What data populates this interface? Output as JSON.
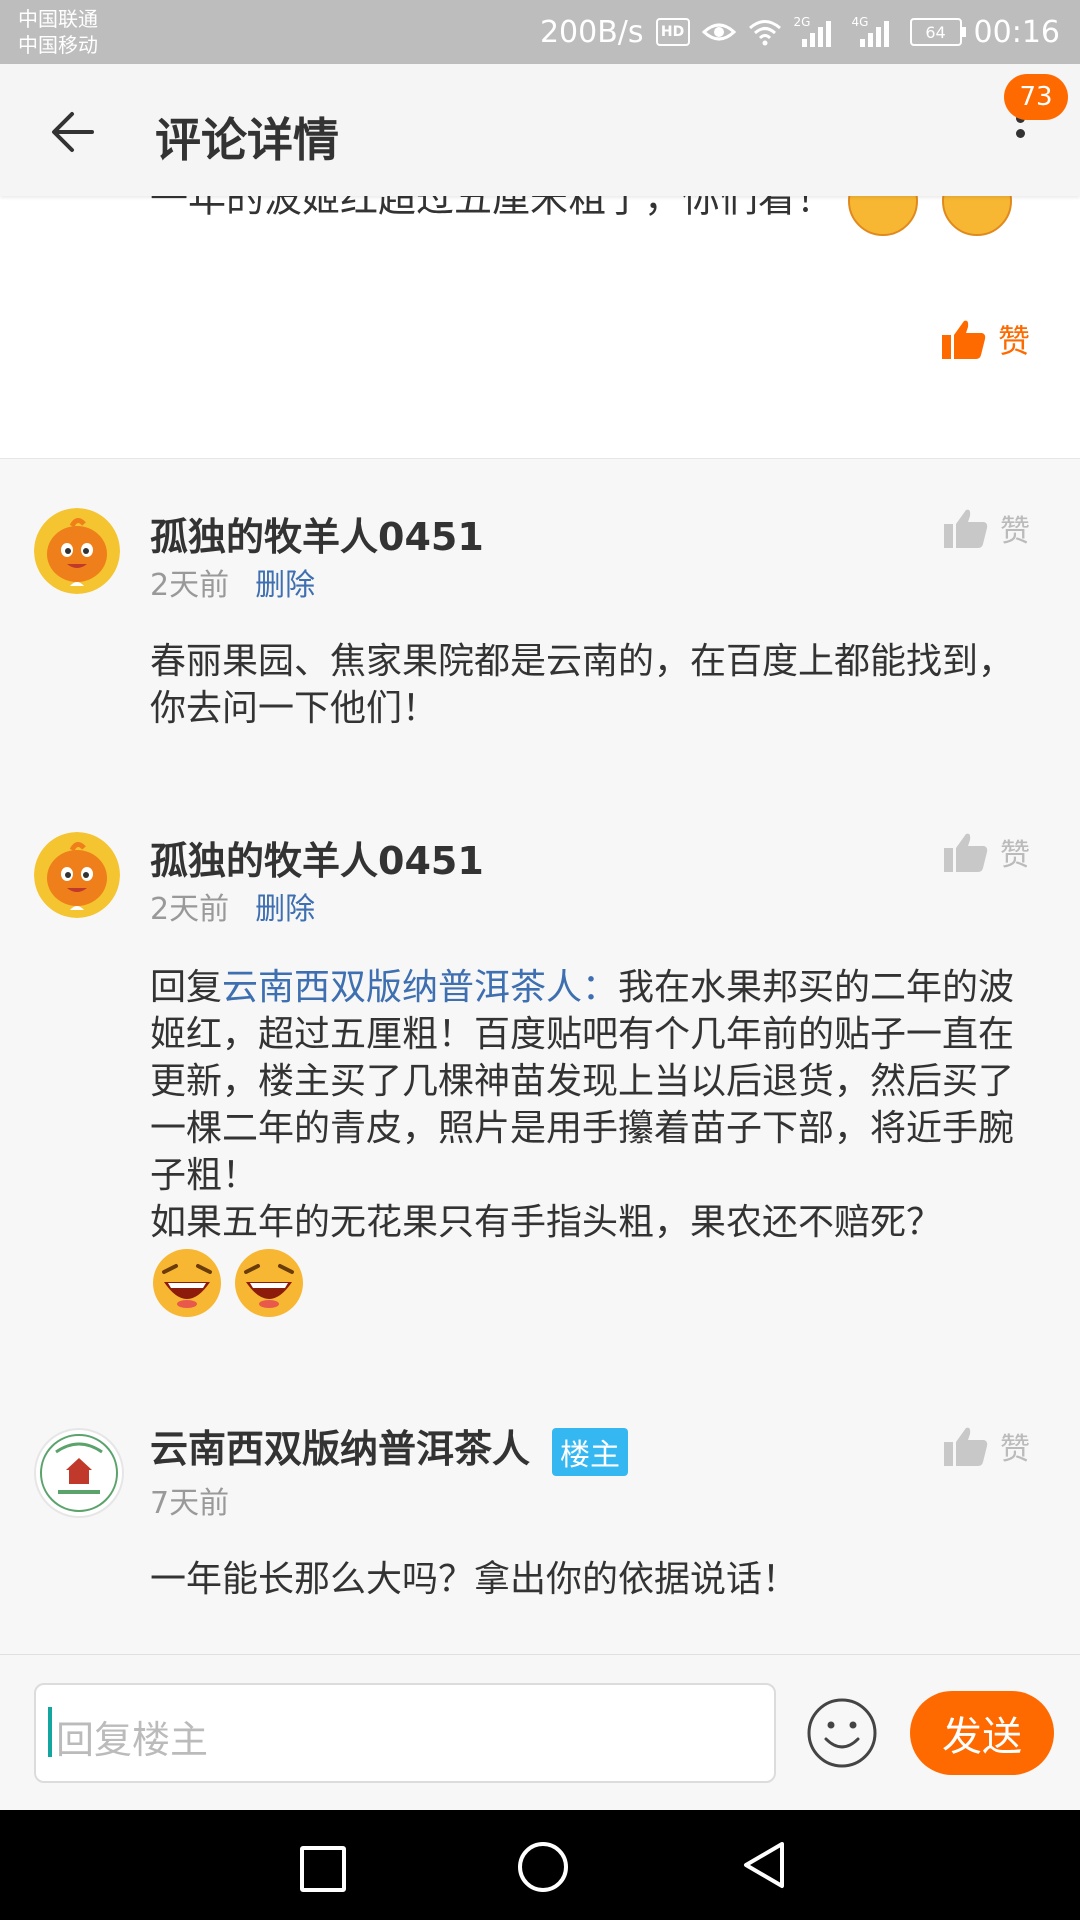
{
  "status_bar": {
    "carrier_1": "中国联通",
    "carrier_2": "中国移动",
    "net_speed": "200B/s",
    "hd": "HD",
    "net_2g": "2G",
    "net_4g": "4G",
    "battery": "64",
    "time": "00:16"
  },
  "header": {
    "title": "评论详情",
    "badge_count": "73"
  },
  "top_card": {
    "cut_text": "一年的波姬红超过五厘米粗了，你们看！",
    "like_label": "赞"
  },
  "comments": [
    {
      "username": "孤独的牧羊人0451",
      "time": "2天前",
      "delete_label": "删除",
      "like_label": "赞",
      "text": "春丽果园、焦家果院都是云南的，在百度上都能找到，你去问一下他们！"
    },
    {
      "username": "孤独的牧羊人0451",
      "time": "2天前",
      "delete_label": "删除",
      "like_label": "赞",
      "reply_prefix": "回复",
      "reply_to": "云南西双版纳普洱茶人：",
      "text": "我在水果邦买的二年的波姬红，超过五厘粗！百度贴吧有个几年前的贴子一直在更新，楼主买了几棵神苗发现上当以后退货，然后买了一棵二年的青皮，照片是用手攥着苗子下部，将近手腕子粗！",
      "text_2": "如果五年的无花果只有手指头粗，果农还不赔死？"
    },
    {
      "username": "云南西双版纳普洱茶人",
      "owner_tag": "楼主",
      "time": "7天前",
      "like_label": "赞",
      "text": "一年能长那么大吗？拿出你的依据说话！"
    }
  ],
  "input_bar": {
    "placeholder": "回复楼主",
    "send_label": "发送"
  },
  "colors": {
    "accent": "#ff6a00",
    "link": "#3e6fb0",
    "owner_tag": "#35b7f2"
  }
}
